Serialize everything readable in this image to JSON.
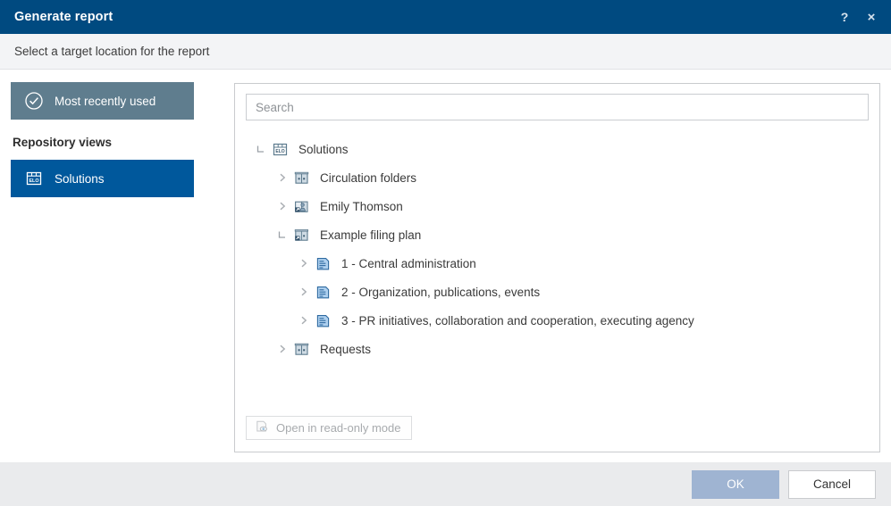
{
  "window": {
    "title": "Generate report",
    "help_label": "?",
    "close_label": "×"
  },
  "subheader": {
    "text": "Select a target location for the report"
  },
  "sidebar": {
    "items": [
      {
        "label": "Most recently used",
        "icon": "check-circle-icon",
        "state": "normal"
      }
    ],
    "heading": "Repository views",
    "views": [
      {
        "label": "Solutions",
        "icon": "elo-archive-icon",
        "state": "selected"
      }
    ]
  },
  "search": {
    "value": "",
    "placeholder": "Search"
  },
  "tree": {
    "nodes": [
      {
        "label": "Solutions",
        "level": 0,
        "twisty": "expanded",
        "icon": "elo-archive-icon"
      },
      {
        "label": "Circulation folders",
        "level": 1,
        "twisty": "collapsed",
        "icon": "cabinet-icon"
      },
      {
        "label": "Emily Thomson",
        "level": 1,
        "twisty": "collapsed",
        "icon": "shortcut-person-folder-icon"
      },
      {
        "label": "Example filing plan",
        "level": 1,
        "twisty": "expanded",
        "icon": "shortcut-folder-icon"
      },
      {
        "label": "1 - Central administration",
        "level": 2,
        "twisty": "collapsed",
        "icon": "document-lines-icon"
      },
      {
        "label": "2 - Organization, publications, events",
        "level": 2,
        "twisty": "collapsed",
        "icon": "document-lines-icon"
      },
      {
        "label": "3 - PR initiatives, collaboration and cooperation, executing agency",
        "level": 2,
        "twisty": "collapsed",
        "icon": "document-lines-icon"
      },
      {
        "label": "Requests",
        "level": 1,
        "twisty": "collapsed",
        "icon": "cabinet-icon"
      }
    ]
  },
  "readonly": {
    "label": "Open in read-only mode",
    "icon": "document-eye-icon",
    "disabled": "true"
  },
  "footer": {
    "ok_label": "OK",
    "cancel_label": "Cancel"
  },
  "colors": {
    "title_bar": "#004a80",
    "accent_selected": "#00589c",
    "mru_background": "#5f7d8e",
    "ok_button": "#9fb4d2",
    "footer_background": "#eaebed",
    "subheader_background": "#f3f4f6"
  }
}
